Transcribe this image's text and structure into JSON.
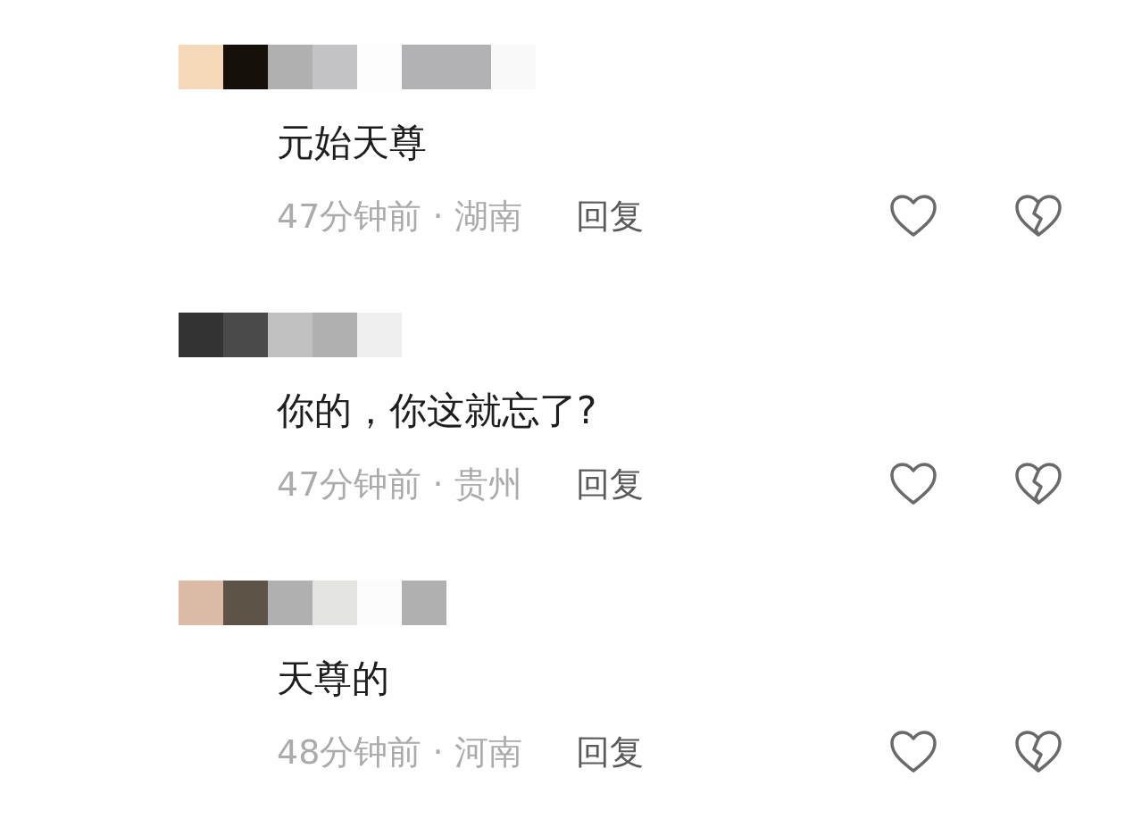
{
  "comments": [
    {
      "mosaic": [
        {
          "color": "#f5d8b8"
        },
        {
          "color": "#15110a"
        },
        {
          "color": "#b0b0b0"
        },
        {
          "color": "#c4c4c6"
        },
        {
          "color": "#fdfdfd"
        },
        {
          "color": "#b2b2b4"
        },
        {
          "color": "#b2b2b4"
        },
        {
          "color": "#f9f9f9"
        }
      ],
      "text": "元始天尊",
      "meta": "47分钟前 · 湖南",
      "reply": "回复"
    },
    {
      "mosaic": [
        {
          "color": "#333333"
        },
        {
          "color": "#4a4a4a"
        },
        {
          "color": "#c0c0c0"
        },
        {
          "color": "#b0b0b0"
        },
        {
          "color": "#efefef"
        }
      ],
      "text": "你的，你这就忘了?",
      "meta": "47分钟前 · 贵州",
      "reply": "回复"
    },
    {
      "mosaic": [
        {
          "color": "#dbbba6"
        },
        {
          "color": "#5d5346"
        },
        {
          "color": "#b0b0b0"
        },
        {
          "color": "#e4e4e2"
        },
        {
          "color": "#fcfcfc"
        },
        {
          "color": "#b0b0b0"
        }
      ],
      "text": "天尊的",
      "meta": "48分钟前 · 河南",
      "reply": "回复"
    }
  ]
}
